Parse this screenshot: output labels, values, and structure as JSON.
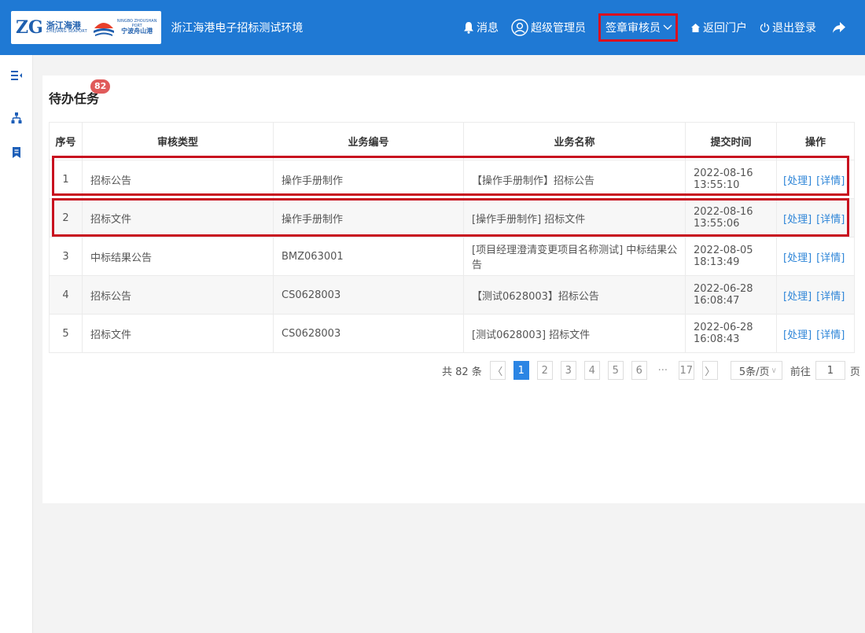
{
  "header": {
    "logo_mark": "ZG",
    "logo_cn": "浙江海港",
    "logo_en": "ZHEJIANG SEAPORT",
    "logo_nb_top": "NINGBO ZHOUSHAN",
    "logo_nb_en": "PORT",
    "logo_nb_cn": "宁波舟山港",
    "app_title": "浙江海港电子招标测试环境",
    "nav": {
      "messages": "消息",
      "admin": "超级管理员",
      "role": "签章审核员",
      "portal": "返回门户",
      "logout": "退出登录"
    }
  },
  "page": {
    "title": "待办任务",
    "badge": "82"
  },
  "table": {
    "headers": [
      "序号",
      "审核类型",
      "业务编号",
      "业务名称",
      "提交时间",
      "操作"
    ],
    "op_handle": "[处理]",
    "op_detail": "[详情]",
    "rows": [
      {
        "idx": "1",
        "type": "招标公告",
        "code": "操作手册制作",
        "name": "【操作手册制作】招标公告",
        "time": "2022-08-16 13:55:10"
      },
      {
        "idx": "2",
        "type": "招标文件",
        "code": "操作手册制作",
        "name": "[操作手册制作] 招标文件",
        "time": "2022-08-16 13:55:06"
      },
      {
        "idx": "3",
        "type": "中标结果公告",
        "code": "BMZ063001",
        "name": "[项目经理澄清变更项目名称测试] 中标结果公告",
        "time": "2022-08-05 18:13:49"
      },
      {
        "idx": "4",
        "type": "招标公告",
        "code": "CS0628003",
        "name": "【测试0628003】招标公告",
        "time": "2022-06-28 16:08:47"
      },
      {
        "idx": "5",
        "type": "招标文件",
        "code": "CS0628003",
        "name": "[测试0628003] 招标文件",
        "time": "2022-06-28 16:08:43"
      }
    ]
  },
  "pagination": {
    "total": "共 82 条",
    "prev": "〈",
    "next": "〉",
    "pages": [
      "1",
      "2",
      "3",
      "4",
      "5",
      "6"
    ],
    "ellipsis": "···",
    "last": "17",
    "page_size": "5条/页",
    "goto_prefix": "前往",
    "goto_value": "1",
    "goto_suffix": "页"
  },
  "colors": {
    "header_bg": "#1f79d4",
    "highlight": "#c8101f",
    "link": "#2f86d8",
    "badge": "#e05b5b",
    "active_page": "#2b85e4"
  },
  "icons": [
    "bell-icon",
    "user-circle-icon",
    "chevron-down-icon",
    "home-icon",
    "power-icon",
    "share-icon",
    "menu-collapse-icon",
    "org-tree-icon",
    "bookmark-icon"
  ]
}
